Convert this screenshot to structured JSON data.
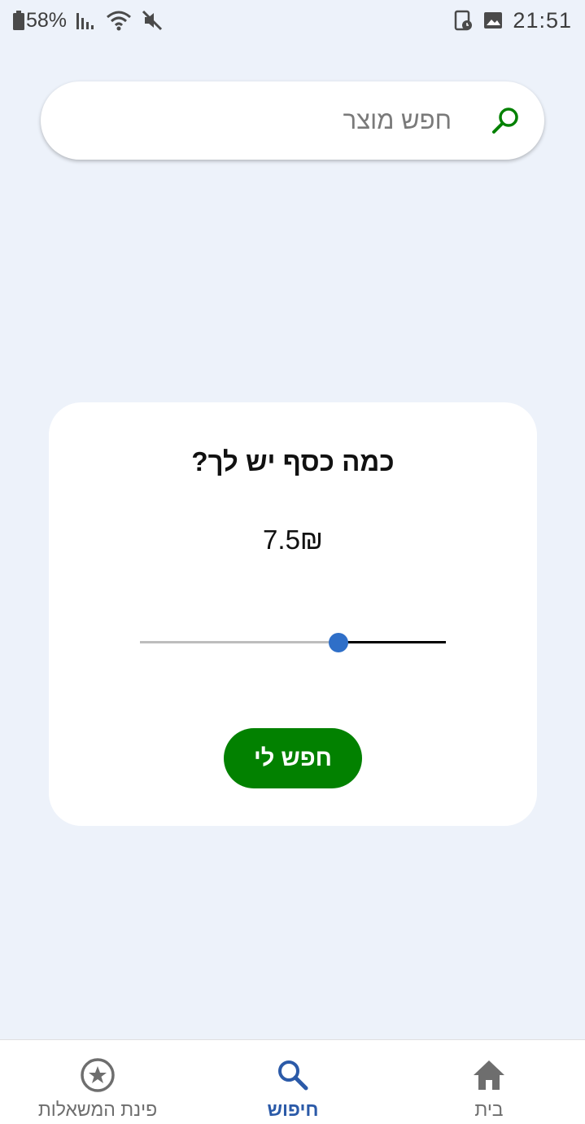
{
  "status_bar": {
    "battery": "58%",
    "time": "21:51"
  },
  "search": {
    "placeholder": "חפש מוצר"
  },
  "budget_card": {
    "title": "כמה כסף יש לך?",
    "amount": "7.5₪",
    "slider_fraction": 0.35,
    "button_label": "חפש לי"
  },
  "bottom_nav": {
    "items": [
      {
        "label": "פינת המשאלות",
        "icon": "star-circle-icon",
        "active": false
      },
      {
        "label": "חיפוש",
        "icon": "search-icon",
        "active": true
      },
      {
        "label": "בית",
        "icon": "home-icon",
        "active": false
      }
    ]
  },
  "colors": {
    "background": "#edf2fa",
    "accent_green": "#028100",
    "accent_blue": "#2b5aa8",
    "slider_thumb": "#2f6fc8"
  }
}
